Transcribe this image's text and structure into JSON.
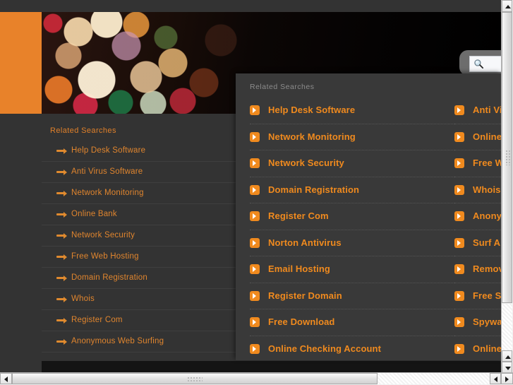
{
  "window": {
    "background_color": "#333333",
    "accent_color": "#e8822a",
    "link_color": "#f08a1e"
  },
  "hero": {
    "orange_block_name": "orange-brand-block",
    "photo_name": "bokeh-lights-photo"
  },
  "search": {
    "icon": "magnifier-icon",
    "value": "",
    "placeholder": ""
  },
  "sidebar": {
    "heading": "Related Searches",
    "items": [
      {
        "label": "Help Desk Software"
      },
      {
        "label": "Anti Virus Software"
      },
      {
        "label": "Network Monitoring"
      },
      {
        "label": "Online Bank"
      },
      {
        "label": "Network Security"
      },
      {
        "label": "Free Web Hosting"
      },
      {
        "label": "Domain Registration"
      },
      {
        "label": "Whois"
      },
      {
        "label": "Register Com"
      },
      {
        "label": "Anonymous Web Surfing"
      }
    ]
  },
  "overlay": {
    "heading": "Related Searches",
    "column_left": [
      {
        "label": "Help Desk Software"
      },
      {
        "label": "Network Monitoring"
      },
      {
        "label": "Network Security"
      },
      {
        "label": "Domain Registration"
      },
      {
        "label": "Register Com"
      },
      {
        "label": "Norton Antivirus"
      },
      {
        "label": "Email Hosting"
      },
      {
        "label": "Register Domain"
      },
      {
        "label": "Free Download"
      },
      {
        "label": "Online Checking Account"
      }
    ],
    "column_right": [
      {
        "label": "Anti Virus Software"
      },
      {
        "label": "Online Bank"
      },
      {
        "label": "Free Web Hosting"
      },
      {
        "label": "Whois"
      },
      {
        "label": "Anonymous Web Surfing"
      },
      {
        "label": "Surf Anonymously"
      },
      {
        "label": "Remove Spyware"
      },
      {
        "label": "Free Software"
      },
      {
        "label": "Spyware Removal"
      },
      {
        "label": "Online Banking"
      }
    ]
  },
  "scrollbars": {
    "vertical_up": "scroll-up-arrow",
    "vertical_down": "scroll-down-arrow",
    "horizontal_left": "scroll-left-arrow",
    "horizontal_right": "scroll-right-arrow"
  }
}
